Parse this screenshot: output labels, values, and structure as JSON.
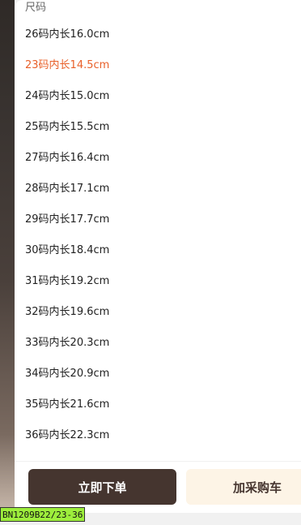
{
  "section": {
    "title": "尺码"
  },
  "sizes": [
    {
      "label": "26码内长16.0cm",
      "selected": false
    },
    {
      "label": "23码内长14.5cm",
      "selected": true
    },
    {
      "label": "24码内长15.0cm",
      "selected": false
    },
    {
      "label": "25码内长15.5cm",
      "selected": false
    },
    {
      "label": "27码内长16.4cm",
      "selected": false
    },
    {
      "label": "28码内长17.1cm",
      "selected": false
    },
    {
      "label": "29码内长17.7cm",
      "selected": false
    },
    {
      "label": "30码内长18.4cm",
      "selected": false
    },
    {
      "label": "31码内长19.2cm",
      "selected": false
    },
    {
      "label": "32码内长19.6cm",
      "selected": false
    },
    {
      "label": "33码内长20.3cm",
      "selected": false
    },
    {
      "label": "34码内长20.9cm",
      "selected": false
    },
    {
      "label": "35码内长21.6cm",
      "selected": false
    },
    {
      "label": "36码内长22.3cm",
      "selected": false
    }
  ],
  "actions": {
    "order_label": "立即下单",
    "cart_label": "加采购车"
  },
  "sku_tag": "BN1209B22/23-36",
  "colors": {
    "selected_text": "#e8602a",
    "order_button_bg": "#45352f",
    "cart_button_bg": "#fdf4e6",
    "sku_tag_bg": "#9dee3c"
  }
}
